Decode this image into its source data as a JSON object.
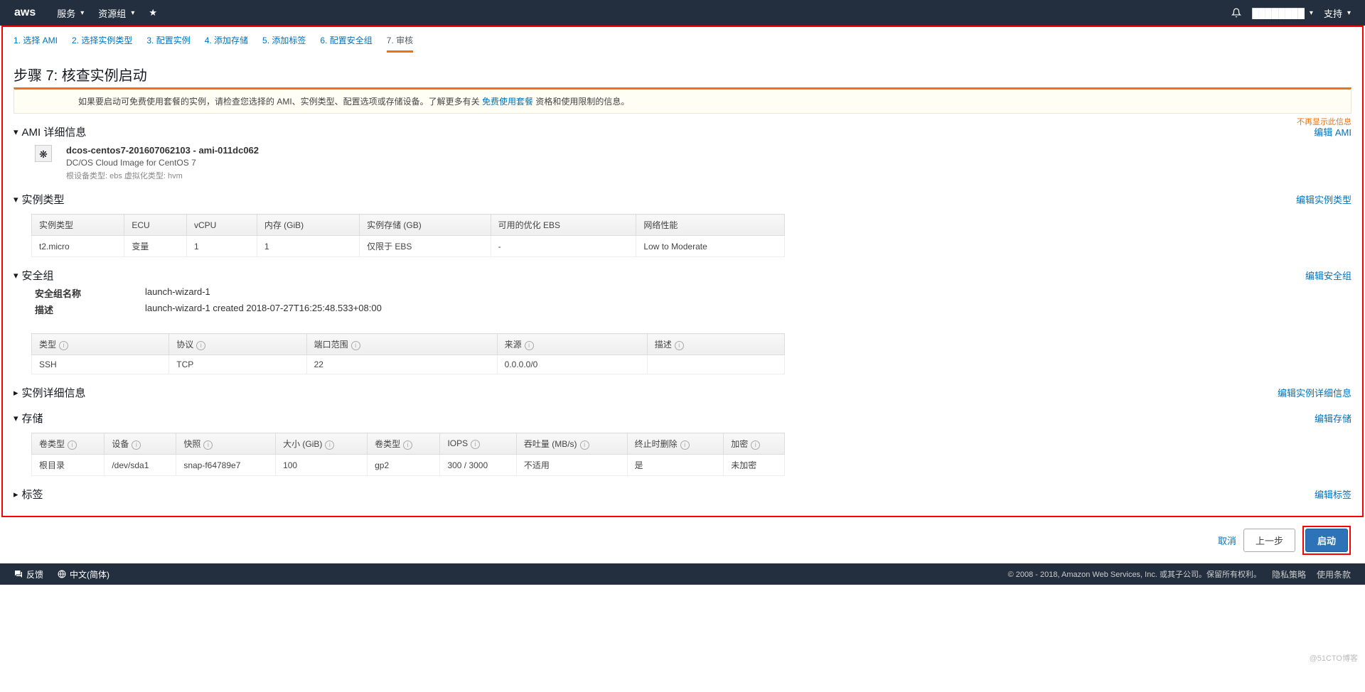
{
  "topnav": {
    "logo": "aws",
    "services": "服务",
    "resource_groups": "资源组",
    "account_masked": "████████",
    "support": "支持"
  },
  "steps": {
    "s1": "1. 选择 AMI",
    "s2": "2. 选择实例类型",
    "s3": "3. 配置实例",
    "s4": "4. 添加存储",
    "s5": "5. 添加标签",
    "s6": "6. 配置安全组",
    "s7": "7. 审核"
  },
  "page_title": "步骤 7: 核查实例启动",
  "banner": {
    "prefix": "如果要启动可免费使用套餐的实例，请检查您选择的 AMI、实例类型、配置选项或存储设备。了解更多有关 ",
    "link": "免费使用套餐",
    "suffix": " 资格和使用限制的信息。",
    "dismiss": "不再显示此信息"
  },
  "ami": {
    "heading": "AMI 详细信息",
    "edit": "编辑 AMI",
    "title": "dcos-centos7-201607062103 - ami-011dc062",
    "desc": "DC/OS Cloud Image for CentOS 7",
    "meta": "根设备类型: ebs    虚拟化类型: hvm"
  },
  "instance": {
    "heading": "实例类型",
    "edit": "编辑实例类型",
    "headers": {
      "type": "实例类型",
      "ecu": "ECU",
      "vcpu": "vCPU",
      "mem": "内存 (GiB)",
      "storage": "实例存储 (GB)",
      "ebs": "可用的优化 EBS",
      "net": "网络性能"
    },
    "row": {
      "type": "t2.micro",
      "ecu": "变量",
      "vcpu": "1",
      "mem": "1",
      "storage": "仅限于 EBS",
      "ebs": "-",
      "net": "Low to Moderate"
    }
  },
  "sg": {
    "heading": "安全组",
    "edit": "编辑安全组",
    "name_label": "安全组名称",
    "name_value": "launch-wizard-1",
    "desc_label": "描述",
    "desc_value": "launch-wizard-1 created 2018-07-27T16:25:48.533+08:00",
    "headers": {
      "type": "类型",
      "proto": "协议",
      "port": "端口范围",
      "source": "来源",
      "desc": "描述"
    },
    "row": {
      "type": "SSH",
      "proto": "TCP",
      "port": "22",
      "source": "0.0.0.0/0",
      "desc": ""
    }
  },
  "instance_detail": {
    "heading": "实例详细信息",
    "edit": "编辑实例详细信息"
  },
  "storage": {
    "heading": "存储",
    "edit": "编辑存储",
    "headers": {
      "vtype": "卷类型",
      "dev": "设备",
      "snap": "快照",
      "size": "大小 (GiB)",
      "vol": "卷类型",
      "iops": "IOPS",
      "tput": "吞吐量 (MB/s)",
      "delterm": "终止时删除",
      "enc": "加密"
    },
    "row": {
      "vtype": "根目录",
      "dev": "/dev/sda1",
      "snap": "snap-f64789e7",
      "size": "100",
      "vol": "gp2",
      "iops": "300 / 3000",
      "tput": "不适用",
      "delterm": "是",
      "enc": "未加密"
    }
  },
  "tags": {
    "heading": "标签",
    "edit": "编辑标签"
  },
  "footer": {
    "cancel": "取消",
    "prev": "上一步",
    "launch": "启动"
  },
  "botnav": {
    "feedback": "反馈",
    "lang": "中文(简体)",
    "copyright": "© 2008 - 2018, Amazon Web Services, Inc. 或其子公司。保留所有权利。",
    "privacy": "隐私策略",
    "terms": "使用条款"
  },
  "watermark": "@51CTO博客"
}
